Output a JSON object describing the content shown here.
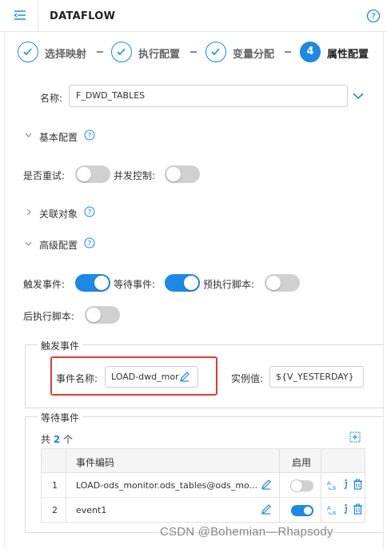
{
  "header": {
    "title": "DATAFLOW"
  },
  "steps": [
    {
      "label": "选择映射",
      "state": "done"
    },
    {
      "label": "执行配置",
      "state": "done"
    },
    {
      "label": "变量分配",
      "state": "done"
    },
    {
      "label": "属性配置",
      "state": "active",
      "number": "4"
    }
  ],
  "name_field": {
    "label": "名称:",
    "value": "F_DWD_TABLES"
  },
  "basic": {
    "title": "基本配置",
    "retry_label": "是否重试:",
    "retry_on": false,
    "concurrency_label": "并发控制:",
    "concurrency_on": false
  },
  "related": {
    "title": "关联对象"
  },
  "advanced": {
    "title": "高级配置",
    "trigger_label": "触发事件:",
    "trigger_on": true,
    "wait_label": "等待事件:",
    "wait_on": true,
    "pre_script_label": "预执行脚本:",
    "pre_script_on": false,
    "post_script_label": "后执行脚本:",
    "post_script_on": false
  },
  "trigger_event": {
    "legend": "触发事件",
    "name_label": "事件名称:",
    "name_value": "LOAD-dwd_mor",
    "instance_label": "实例值:",
    "instance_value": "${V_YESTERDAY}"
  },
  "wait_event": {
    "legend": "等待事件",
    "count_prefix": "共",
    "count": "2",
    "count_suffix": "个",
    "columns": {
      "code": "事件编码",
      "enabled": "启用"
    },
    "rows": [
      {
        "index": "1",
        "code": "LOAD-ods_monitor.ods_tables@ods_mo...",
        "enabled": false
      },
      {
        "index": "2",
        "code": "event1",
        "enabled": true
      }
    ]
  },
  "watermark": "CSDN @Bohemian—Rhapsody",
  "colors": {
    "accent": "#1e88e5",
    "highlight": "#e53935"
  }
}
